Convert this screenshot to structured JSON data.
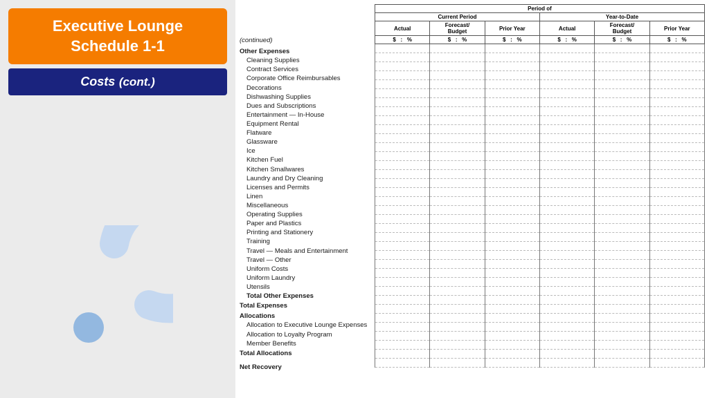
{
  "title": "Executive Lounge\nSchedule 1-1",
  "subtitle": "Costs",
  "subtitle_cont": "(cont.)",
  "continued_label": "(continued)",
  "table": {
    "period_header": "Period of",
    "current_period": "Current Period",
    "year_to_date": "Year-to-Date",
    "col_actual": "Actual",
    "col_forecast": "Forecast/\nBudget",
    "col_prior_year": "Prior Year",
    "dollar_sign": "$",
    "percent_sign": "%",
    "separator": ":"
  },
  "items": [
    {
      "label": "Other Expenses",
      "type": "section"
    },
    {
      "label": "Cleaning Supplies",
      "type": "indent"
    },
    {
      "label": "Contract Services",
      "type": "indent"
    },
    {
      "label": "Corporate Office Reimbursables",
      "type": "indent"
    },
    {
      "label": "Decorations",
      "type": "indent"
    },
    {
      "label": "Dishwashing Supplies",
      "type": "indent"
    },
    {
      "label": "Dues and Subscriptions",
      "type": "indent"
    },
    {
      "label": "Entertainment — In-House",
      "type": "indent"
    },
    {
      "label": "Equipment Rental",
      "type": "indent"
    },
    {
      "label": "Flatware",
      "type": "indent"
    },
    {
      "label": "Glassware",
      "type": "indent"
    },
    {
      "label": "Ice",
      "type": "indent"
    },
    {
      "label": "Kitchen Fuel",
      "type": "indent"
    },
    {
      "label": "Kitchen Smallwares",
      "type": "indent"
    },
    {
      "label": "Laundry and Dry Cleaning",
      "type": "indent"
    },
    {
      "label": "Licenses and Permits",
      "type": "indent"
    },
    {
      "label": "Linen",
      "type": "indent"
    },
    {
      "label": "Miscellaneous",
      "type": "indent"
    },
    {
      "label": "Operating Supplies",
      "type": "indent"
    },
    {
      "label": "Paper and Plastics",
      "type": "indent"
    },
    {
      "label": "Printing and Stationery",
      "type": "indent"
    },
    {
      "label": "Training",
      "type": "indent"
    },
    {
      "label": "Travel — Meals and Entertainment",
      "type": "indent"
    },
    {
      "label": "Travel — Other",
      "type": "indent"
    },
    {
      "label": "Uniform Costs",
      "type": "indent"
    },
    {
      "label": "Uniform Laundry",
      "type": "indent"
    },
    {
      "label": "Utensils",
      "type": "indent"
    },
    {
      "label": "Total Other Expenses",
      "type": "total"
    },
    {
      "label": "Total Expenses",
      "type": "bold"
    },
    {
      "label": "Allocations",
      "type": "section"
    },
    {
      "label": "Allocation to Executive Lounge Expenses",
      "type": "indent"
    },
    {
      "label": "Allocation to Loyalty Program",
      "type": "indent"
    },
    {
      "label": "Member Benefits",
      "type": "indent"
    },
    {
      "label": "Total Allocations",
      "type": "bold"
    },
    {
      "label": "",
      "type": "spacer"
    },
    {
      "label": "Net Recovery",
      "type": "bold"
    }
  ],
  "num_data_rows": 36
}
